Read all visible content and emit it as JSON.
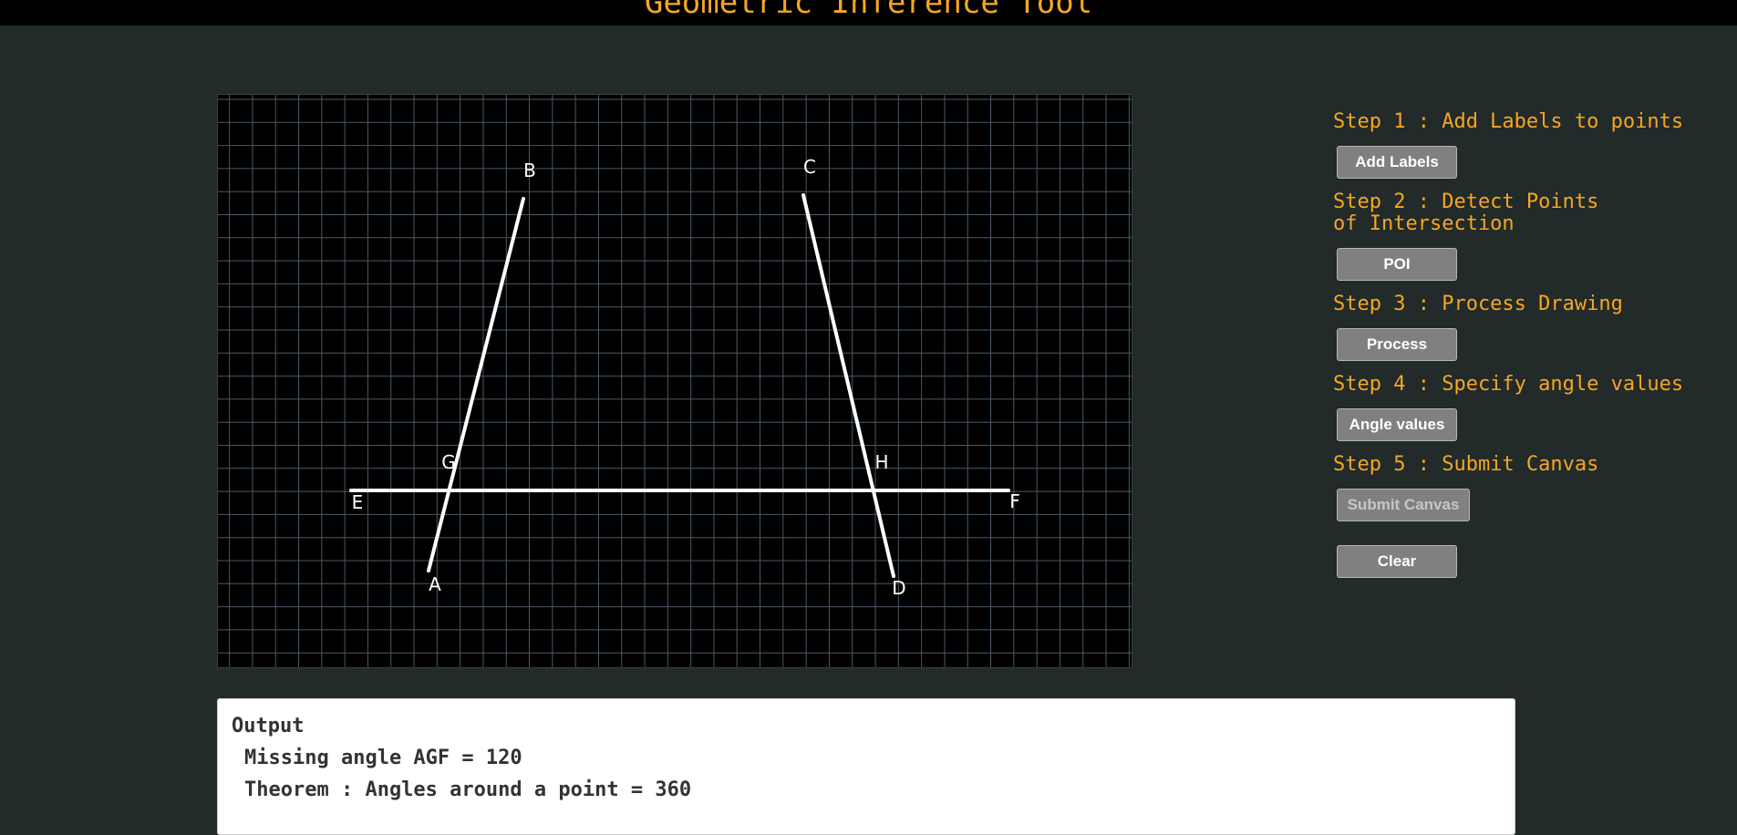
{
  "app": {
    "title": "Geometric Inference Tool"
  },
  "colors": {
    "background": "#222a2a",
    "accent": "#f5a623",
    "canvas": "#000000",
    "grid": "#4a5866",
    "stroke": "#ffffff",
    "button": "#808080"
  },
  "canvas": {
    "lines": [
      {
        "from": "A",
        "to": "B"
      },
      {
        "from": "C",
        "to": "D"
      },
      {
        "from": "E",
        "to": "F"
      }
    ],
    "points": [
      {
        "label": "A"
      },
      {
        "label": "B"
      },
      {
        "label": "C"
      },
      {
        "label": "D"
      },
      {
        "label": "E"
      },
      {
        "label": "F"
      },
      {
        "label": "G"
      },
      {
        "label": "H"
      }
    ]
  },
  "steps": [
    {
      "label": "Step 1 : Add Labels to points",
      "button": "Add Labels",
      "enabled": true
    },
    {
      "label": "Step 2 : Detect Points of Intersection",
      "button": "POI",
      "enabled": true
    },
    {
      "label": "Step 3 : Process Drawing",
      "button": "Process",
      "enabled": true
    },
    {
      "label": "Step 4 : Specify angle values",
      "button": "Angle values",
      "enabled": true
    },
    {
      "label": "Step 5 : Submit Canvas",
      "button": "Submit Canvas",
      "enabled": false
    }
  ],
  "clear_button": "Clear",
  "output": {
    "heading": "Output",
    "lines": [
      "Missing angle AGF = 120",
      "Theorem : Angles around a point = 360"
    ]
  }
}
